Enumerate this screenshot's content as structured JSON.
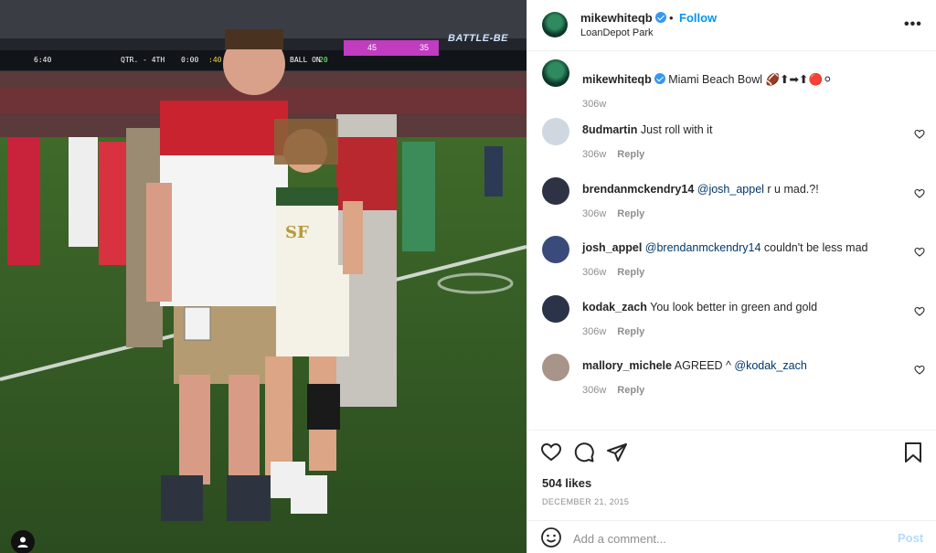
{
  "photo": {
    "scoreboard": {
      "time": "6:40",
      "quarter": "QTR. - 4TH",
      "clock": "0:00",
      "play_clock": ":40",
      "ball_on_label": "BALL ON",
      "ball_on_value": "20",
      "score_a": "45",
      "score_b": "35",
      "banner": "BATTLE-BE"
    },
    "jersey_text": "SF"
  },
  "header": {
    "username": "mikewhiteqb",
    "separator": "•",
    "follow_label": "Follow",
    "location": "LoanDepot Park",
    "more_label": "•••"
  },
  "caption": {
    "username": "mikewhiteqb",
    "text": "Miami Beach Bowl",
    "emojis": "🏈⬆➡⬆🔴⚪",
    "time": "306w"
  },
  "comments": [
    {
      "username": "8udmartin",
      "text": "Just roll with it",
      "mention": "",
      "text_after": "",
      "time": "306w",
      "reply_label": "Reply",
      "avatar_color": "#cfd8e0"
    },
    {
      "username": "brendanmckendry14",
      "text": "",
      "mention": "@josh_appel",
      "text_after": " r u mad.?!",
      "time": "306w",
      "reply_label": "Reply",
      "avatar_color": "#2d3344"
    },
    {
      "username": "josh_appel",
      "text": "",
      "mention": "@brendanmckendry14",
      "text_after": " couldn't be less mad",
      "time": "306w",
      "reply_label": "Reply",
      "avatar_color": "#3a4a7a"
    },
    {
      "username": "kodak_zach",
      "text": "You look better in green and gold",
      "mention": "",
      "text_after": "",
      "time": "306w",
      "reply_label": "Reply",
      "avatar_color": "#2a3347"
    },
    {
      "username": "mallory_michele",
      "text": "AGREED ^ ",
      "mention": "@kodak_zach",
      "text_after": "",
      "time": "306w",
      "reply_label": "Reply",
      "avatar_color": "#a89488"
    }
  ],
  "engagement": {
    "likes": "504 likes",
    "date": "DECEMBER 21, 2015"
  },
  "add_comment": {
    "placeholder": "Add a comment...",
    "post_label": "Post"
  },
  "colors": {
    "accent": "#0095f6",
    "verified": "#3897f0",
    "mention": "#00376b",
    "muted": "#8e8e8e",
    "post_disabled": "#b3dbff"
  }
}
